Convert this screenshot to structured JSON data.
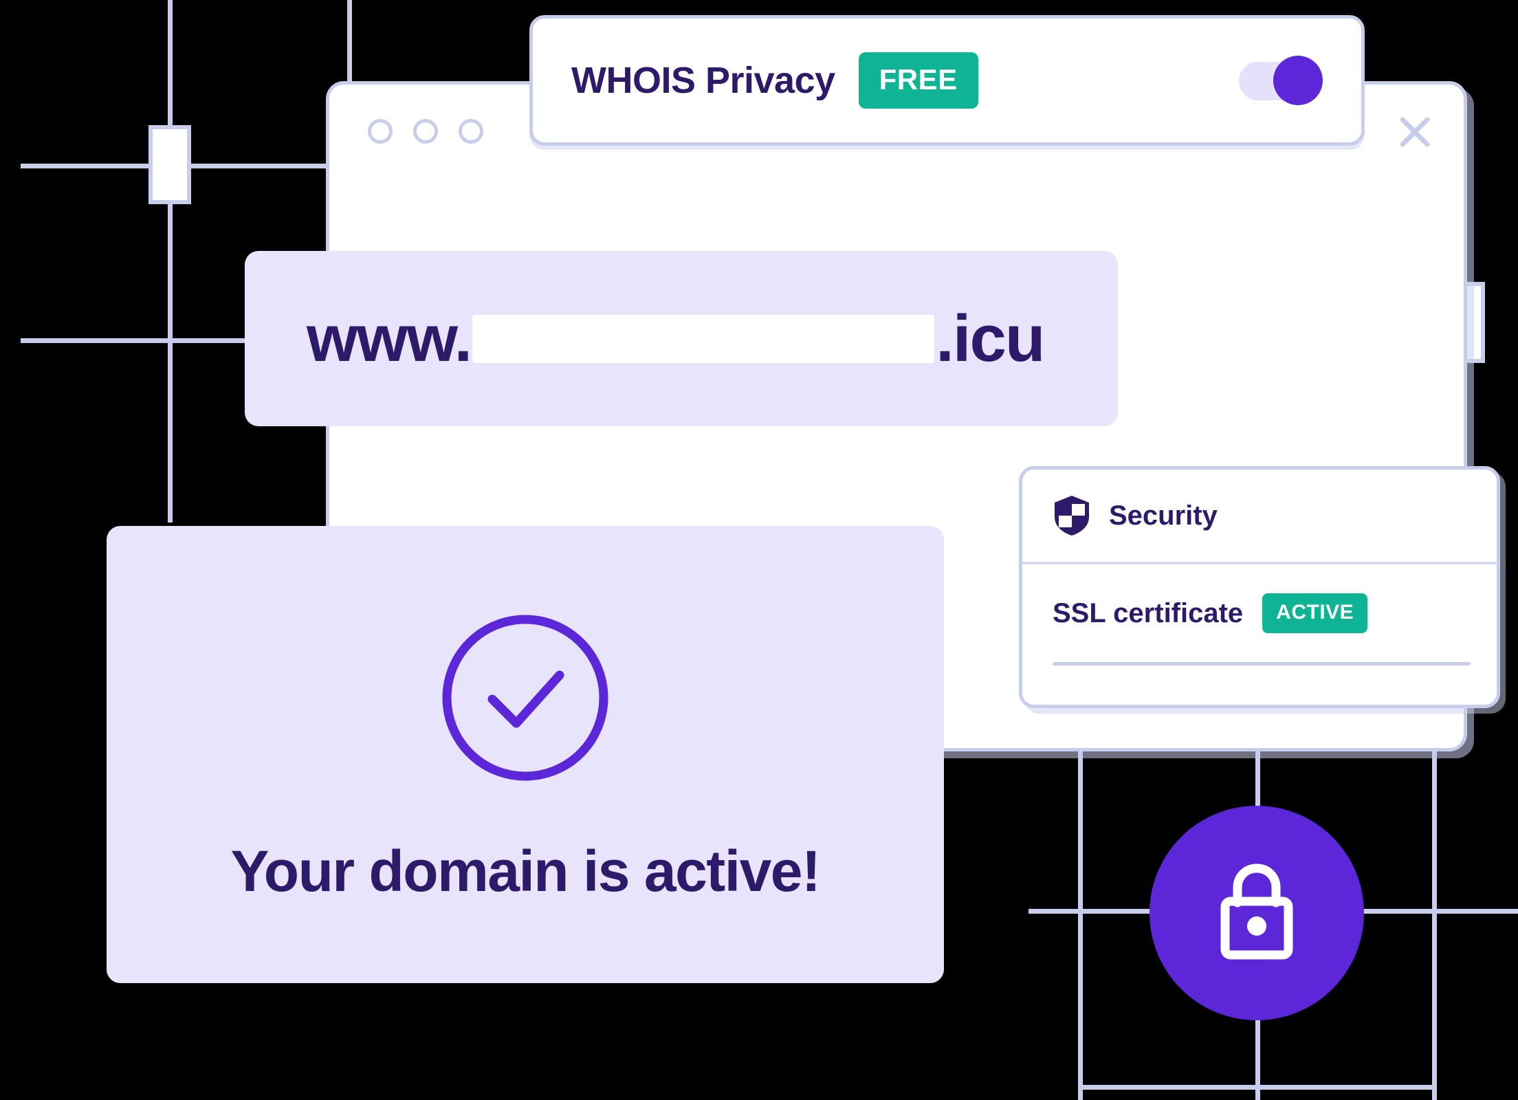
{
  "theme": {
    "background": "#000000",
    "grid_line": "#C8CDEB",
    "card_lavender": "#E8E4FB",
    "accent_purple": "#5B27D9",
    "text_purple": "#2D1B69",
    "accent_green": "#0FB495",
    "window_white": "#FFFFFF"
  },
  "browser_window": {
    "dots": [
      "window-dot-1",
      "window-dot-2",
      "window-dot-3"
    ],
    "close_icon": "close-icon"
  },
  "whois_bar": {
    "label": "WHOIS Privacy",
    "badge": "FREE",
    "toggle_state": "on"
  },
  "url_bar": {
    "prefix": "www.",
    "input_value": "",
    "input_placeholder": "",
    "suffix": ".icu"
  },
  "security_card": {
    "icon": "shield-icon",
    "title": "Security",
    "rows": [
      {
        "label": "SSL certificate",
        "badge": "ACTIVE"
      }
    ]
  },
  "active_card": {
    "icon": "check-circle-icon",
    "message": "Your domain is active!"
  },
  "lock_badge": {
    "icon": "lock-icon"
  }
}
